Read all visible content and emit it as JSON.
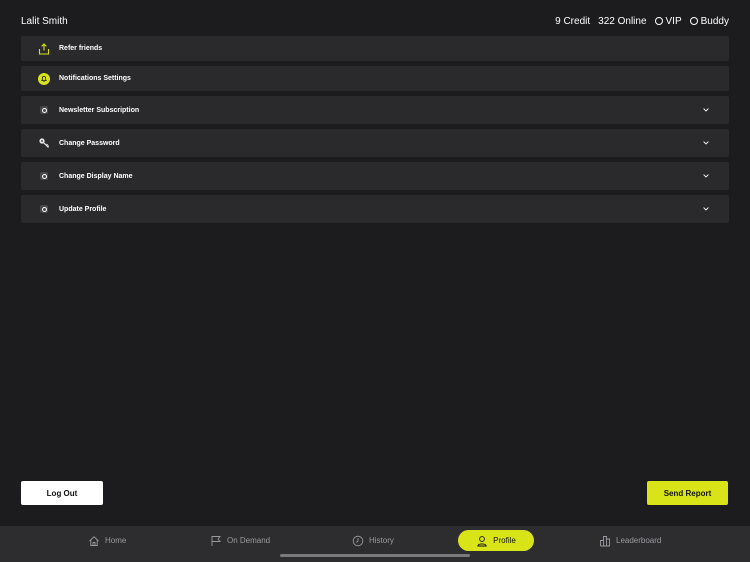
{
  "header": {
    "user_name": "Lalit Smith",
    "credit": "9 Credit",
    "online": "322 Online",
    "vip": "VIP",
    "buddy": "Buddy"
  },
  "menu": {
    "refer_friends": "Refer friends",
    "notifications": "Notifications Settings",
    "newsletter": "Newsletter Subscription",
    "change_password": "Change Password",
    "change_display_name": "Change Display Name",
    "update_profile": "Update Profile"
  },
  "actions": {
    "logout": "Log Out",
    "send_report": "Send Report"
  },
  "tabs": {
    "home": "Home",
    "on_demand": "On Demand",
    "history": "History",
    "profile": "Profile",
    "leaderboard": "Leaderboard"
  },
  "colors": {
    "accent": "#d8e418",
    "background": "#1c1c1e",
    "row": "#2a2a2d"
  },
  "icons": {
    "refer_friends": "share-icon",
    "notifications": "bell-icon",
    "change_password": "key-icon",
    "expand": "chevron-down-icon"
  }
}
